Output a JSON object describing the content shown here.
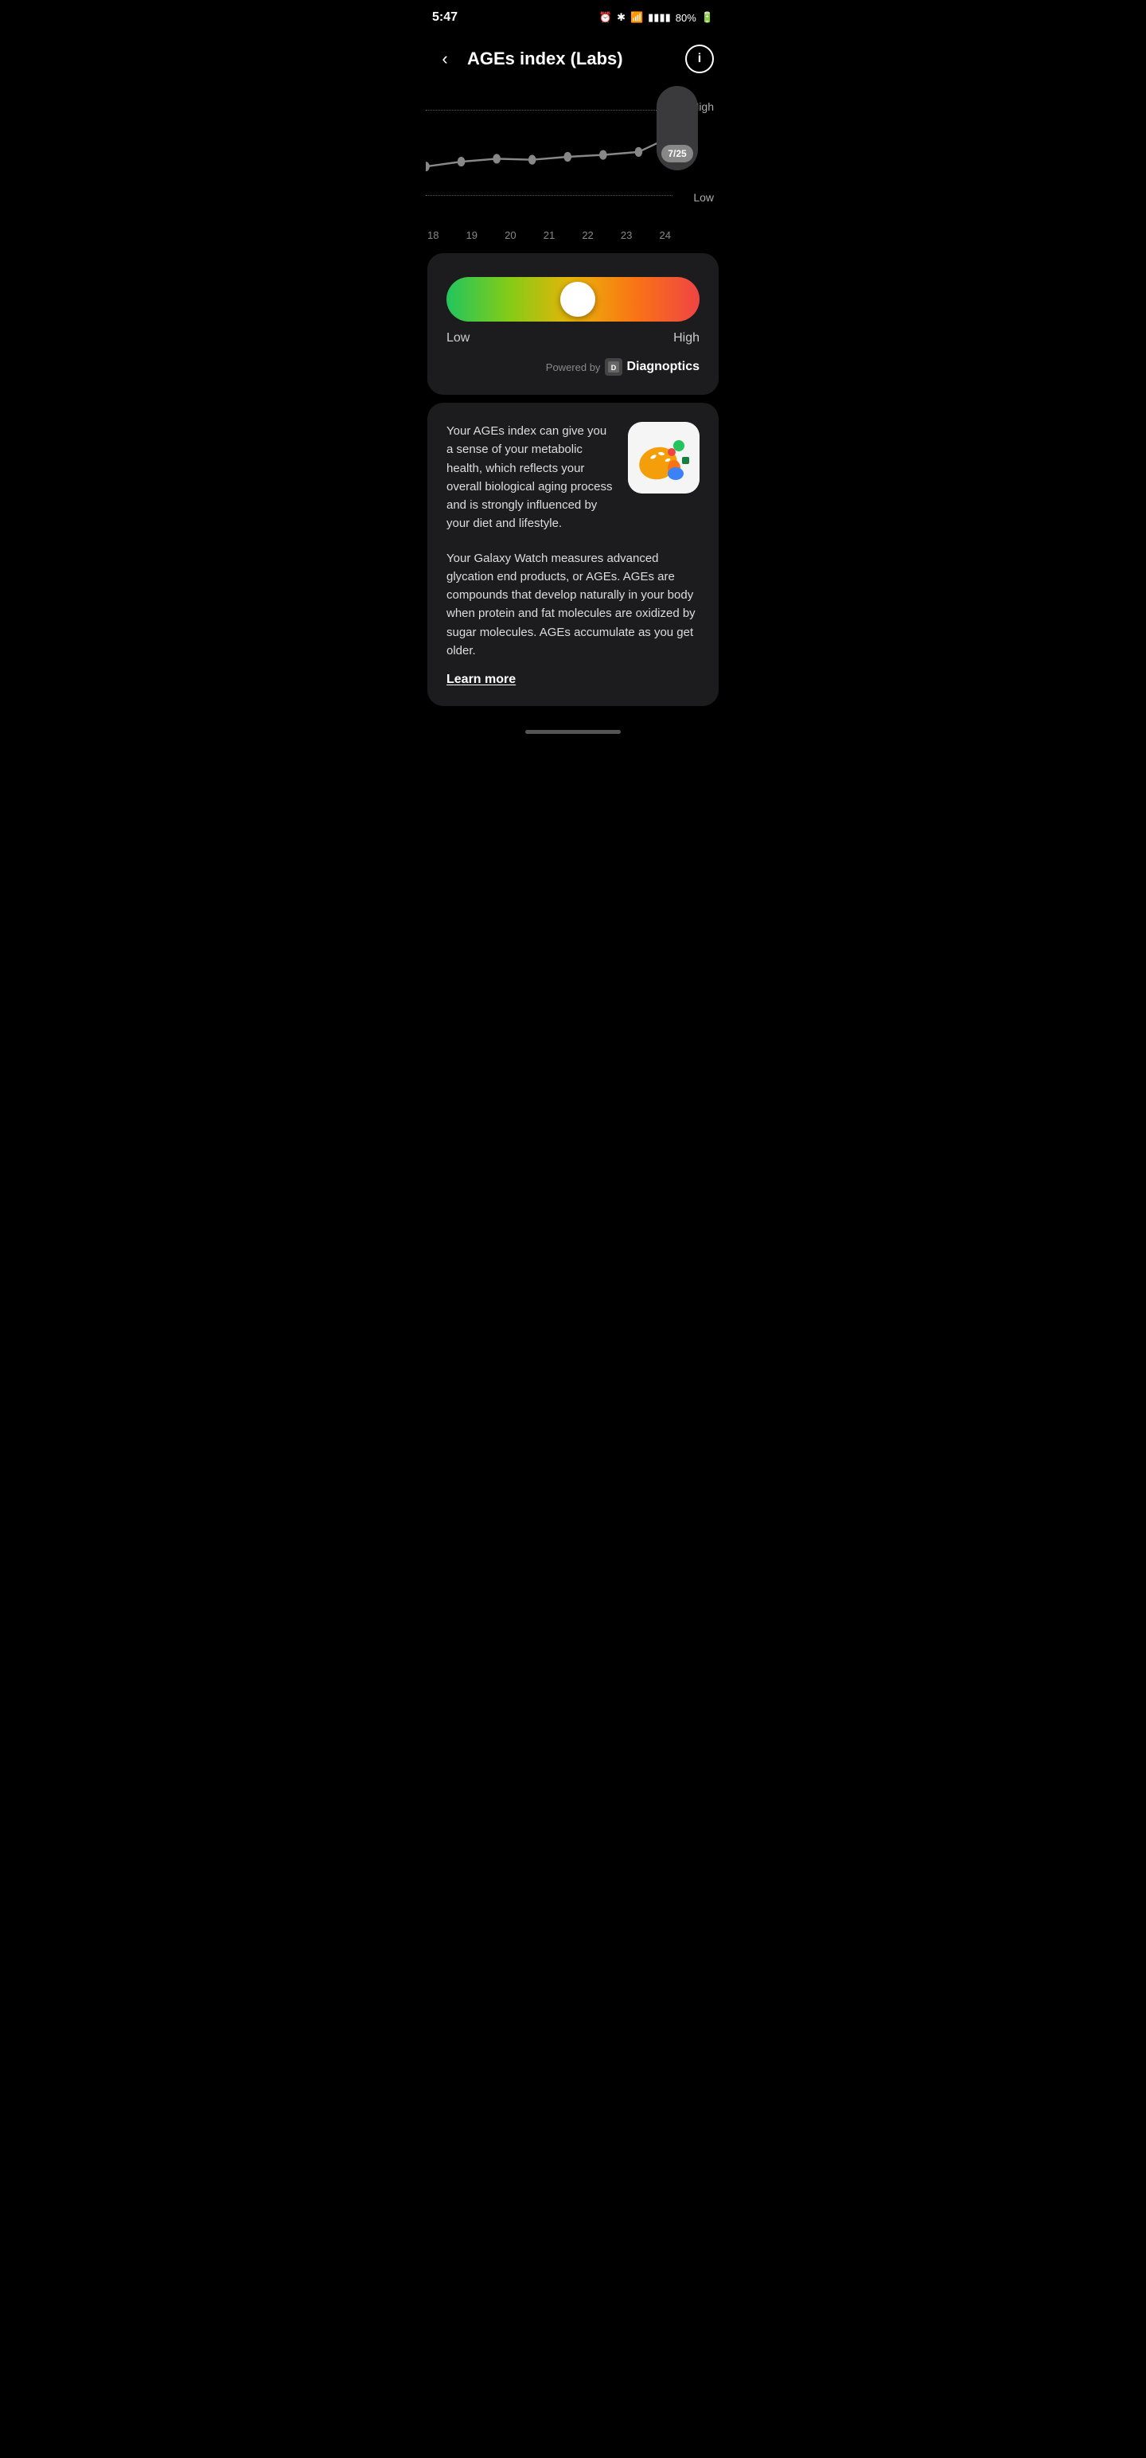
{
  "statusBar": {
    "time": "5:47",
    "battery": "80%",
    "icons": [
      "photo",
      "figure",
      "drive",
      "dot",
      "alarm",
      "bluetooth",
      "wifi",
      "signal"
    ]
  },
  "header": {
    "title": "AGEs index (Labs)",
    "backLabel": "‹",
    "infoLabel": "i"
  },
  "chart": {
    "highLabel": "High",
    "lowLabel": "Low",
    "dates": [
      "18",
      "19",
      "20",
      "21",
      "22",
      "23",
      "24",
      "7/25"
    ],
    "selectedDate": "7/25",
    "tooltipVisible": true
  },
  "gaugeCard": {
    "lowLabel": "Low",
    "highLabel": "High",
    "thumbPosition": 52,
    "poweredByText": "Powered by",
    "brandName": "Diagnoptics"
  },
  "infoCard": {
    "primaryText": "Your AGEs index can give you a sense of your metabolic health, which reflects your overall biological aging process and is strongly influenced by your diet and lifestyle.",
    "secondaryText": "Your Galaxy Watch measures advanced glycation end products, or AGEs. AGEs are compounds that develop naturally in your body when protein and fat molecules are oxidized by sugar molecules. AGEs accumulate as you get older.",
    "learnMoreLabel": "Learn more"
  }
}
